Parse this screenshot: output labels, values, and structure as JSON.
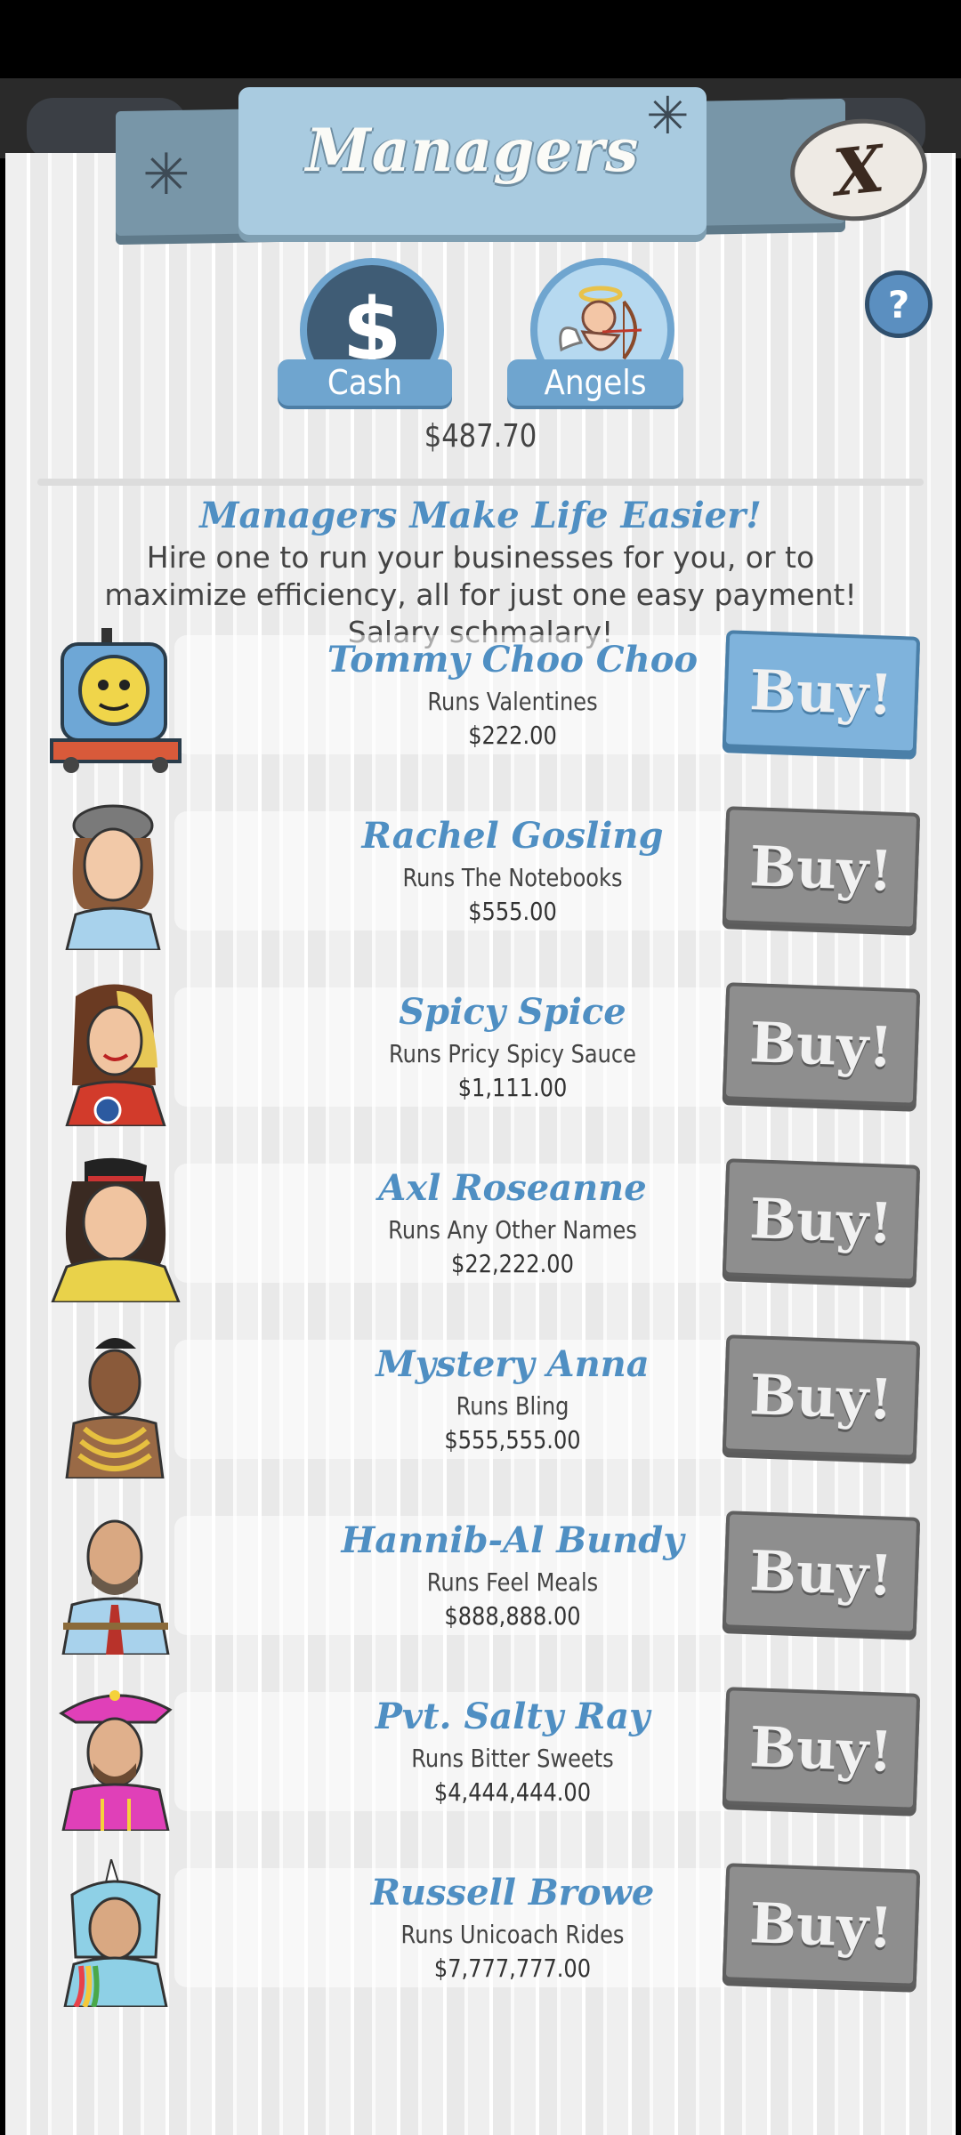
{
  "header": {
    "title": "Managers",
    "close_label": "X",
    "help_label": "?"
  },
  "currency_tabs": [
    {
      "label": "Cash",
      "symbol": "$"
    },
    {
      "label": "Angels"
    }
  ],
  "balance": "$487.70",
  "intro": {
    "tagline": "Managers Make Life Easier!",
    "description": "Hire one to run your businesses for you, or to maximize efficiency, all for just one easy payment! Salary schmalary!"
  },
  "buy_label": "Buy!",
  "managers": [
    {
      "name": "Tommy Choo Choo",
      "runs": "Runs Valentines",
      "price": "$222.00",
      "affordable": true
    },
    {
      "name": "Rachel Gosling",
      "runs": "Runs The Notebooks",
      "price": "$555.00",
      "affordable": false
    },
    {
      "name": "Spicy Spice",
      "runs": "Runs Pricy Spicy Sauce",
      "price": "$1,111.00",
      "affordable": false
    },
    {
      "name": "Axl Roseanne",
      "runs": "Runs Any Other Names",
      "price": "$22,222.00",
      "affordable": false
    },
    {
      "name": "Mystery Anna",
      "runs": "Runs Bling",
      "price": "$555,555.00",
      "affordable": false
    },
    {
      "name": "Hannib-Al Bundy",
      "runs": "Runs Feel Meals",
      "price": "$888,888.00",
      "affordable": false
    },
    {
      "name": "Pvt. Salty Ray",
      "runs": "Runs Bitter Sweets",
      "price": "$4,444,444.00",
      "affordable": false
    },
    {
      "name": "Russell Browe",
      "runs": "Runs Unicoach Rides",
      "price": "$7,777,777.00",
      "affordable": false
    }
  ],
  "colors": {
    "accent_blue": "#4f8fc3",
    "buy_active": "#7fb3dc",
    "buy_disabled": "#8e8e8e"
  }
}
